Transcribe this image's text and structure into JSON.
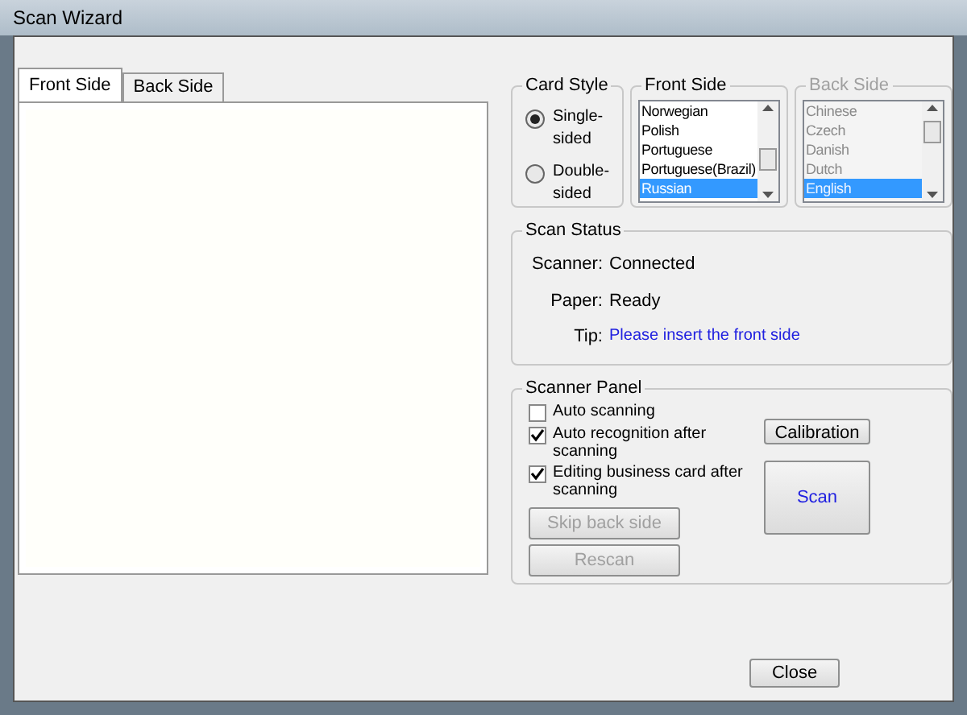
{
  "window": {
    "title": "Scan Wizard"
  },
  "tabs": [
    {
      "label": "Front Side",
      "selected": true
    },
    {
      "label": "Back Side",
      "selected": false
    }
  ],
  "card_style": {
    "title": "Card Style",
    "options": [
      {
        "label": "Single-sided",
        "selected": true
      },
      {
        "label": "Double-sided",
        "selected": false
      }
    ]
  },
  "front_side": {
    "title": "Front Side",
    "disabled": false,
    "items": [
      {
        "label": "Norwegian",
        "selected": false
      },
      {
        "label": "Polish",
        "selected": false
      },
      {
        "label": "Portuguese",
        "selected": false
      },
      {
        "label": "Portuguese(Brazil)",
        "selected": false
      },
      {
        "label": "Russian",
        "selected": true
      }
    ]
  },
  "back_side": {
    "title": "Back Side",
    "disabled": true,
    "items": [
      {
        "label": "Chinese",
        "selected": false
      },
      {
        "label": "Czech",
        "selected": false
      },
      {
        "label": "Danish",
        "selected": false
      },
      {
        "label": "Dutch",
        "selected": false
      },
      {
        "label": "English",
        "selected": true
      }
    ]
  },
  "scan_status": {
    "title": "Scan Status",
    "rows": [
      {
        "label": "Scanner:",
        "value": "Connected",
        "kind": "plain"
      },
      {
        "label": "Paper:",
        "value": "Ready",
        "kind": "plain"
      },
      {
        "label": "Tip:",
        "value": "Please insert the front side",
        "kind": "hint"
      }
    ]
  },
  "scanner_panel": {
    "title": "Scanner Panel",
    "options": [
      {
        "label": "Auto scanning",
        "checked": false
      },
      {
        "label": "Auto recognition after scanning",
        "checked": true
      },
      {
        "label": "Editing business card after scanning",
        "checked": true
      }
    ],
    "buttons": [
      {
        "label": "Skip back side",
        "disabled": true
      },
      {
        "label": "Rescan",
        "disabled": true
      }
    ],
    "calibration": "Calibration",
    "scan": "Scan"
  },
  "close": "Close"
}
